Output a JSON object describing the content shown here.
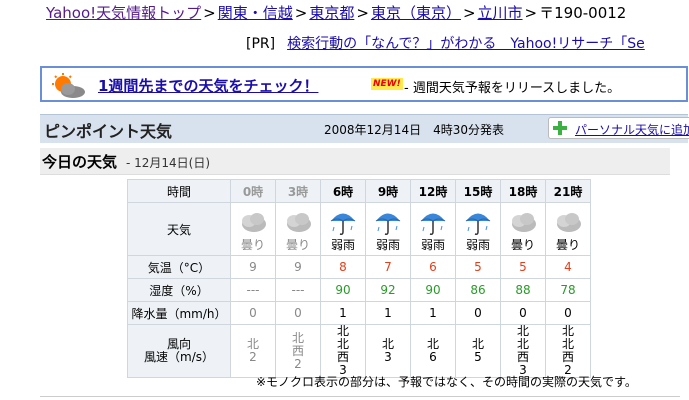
{
  "breadcrumb": {
    "items": [
      {
        "label": "Yahoo!天気情報トップ"
      },
      {
        "label": "関東・信越"
      },
      {
        "label": "東京都"
      },
      {
        "label": "東京（東京）"
      },
      {
        "label": "立川市"
      }
    ],
    "separator": ">",
    "postal": "〒190-0012"
  },
  "ad": {
    "tag": "[PR]",
    "text": "検索行動の「なんで？」がわかる　Yahoo!リサーチ「Se"
  },
  "notice": {
    "link": "1週間先までの天気をチェック！",
    "badge": "NEW!",
    "text": "- 週間天気予報をリリースしました。"
  },
  "pinpoint": {
    "title": "ピンポイント天気",
    "date": "2008年12月14日　4時30分発表",
    "button": "パーソナル天気に追加"
  },
  "today": {
    "heading": "今日の天気",
    "date": "- 12月14日(日)"
  },
  "table": {
    "labels": {
      "time": "時間",
      "weather": "天気",
      "temp": "気温（°C）",
      "humidity": "湿度（%）",
      "precip": "降水量（mm/h）",
      "wind_dir": "風向",
      "wind_speed": "風速（m/s）"
    },
    "columns": [
      {
        "time": "0時",
        "past": true,
        "icon": "cloud-icon",
        "weather": "曇り",
        "temp": "9",
        "humidity": "---",
        "precip": "0",
        "wind_dir": "北",
        "wind_speed": "2"
      },
      {
        "time": "3時",
        "past": true,
        "icon": "cloud-icon",
        "weather": "曇り",
        "temp": "9",
        "humidity": "---",
        "precip": "0",
        "wind_dir": "北西",
        "wind_speed": "2"
      },
      {
        "time": "6時",
        "past": false,
        "icon": "umbrella-icon",
        "weather": "弱雨",
        "temp": "8",
        "humidity": "90",
        "precip": "1",
        "wind_dir": "北北西",
        "wind_speed": "3"
      },
      {
        "time": "9時",
        "past": false,
        "icon": "umbrella-icon",
        "weather": "弱雨",
        "temp": "7",
        "humidity": "92",
        "precip": "1",
        "wind_dir": "北",
        "wind_speed": "3"
      },
      {
        "time": "12時",
        "past": false,
        "icon": "umbrella-icon",
        "weather": "弱雨",
        "temp": "6",
        "humidity": "90",
        "precip": "1",
        "wind_dir": "北",
        "wind_speed": "6"
      },
      {
        "time": "15時",
        "past": false,
        "icon": "umbrella-icon",
        "weather": "弱雨",
        "temp": "5",
        "humidity": "86",
        "precip": "0",
        "wind_dir": "北",
        "wind_speed": "5"
      },
      {
        "time": "18時",
        "past": false,
        "icon": "cloud-icon",
        "weather": "曇り",
        "temp": "5",
        "humidity": "88",
        "precip": "0",
        "wind_dir": "北北西",
        "wind_speed": "3"
      },
      {
        "time": "21時",
        "past": false,
        "icon": "cloud-icon",
        "weather": "曇り",
        "temp": "4",
        "humidity": "78",
        "precip": "0",
        "wind_dir": "北北西",
        "wind_speed": "2"
      }
    ]
  },
  "footnote": "※モノクロ表示の部分は、予報ではなく、その時間の実際の天気です。",
  "colors": {
    "link": "#1a0dab",
    "visited": "#551a8b",
    "temp": "#e0401c",
    "humidity": "#2a9a2a",
    "past": "#888888"
  }
}
